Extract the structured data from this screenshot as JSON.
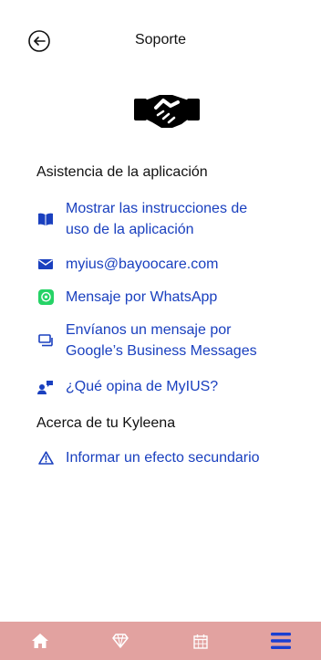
{
  "header": {
    "title": "Soporte",
    "back_icon": "arrow-left-circle-icon"
  },
  "hero": {
    "icon": "handshake-icon"
  },
  "app_support": {
    "title": "Asistencia de la aplicación",
    "items": [
      {
        "icon": "book-icon",
        "line1": "Mostrar las instrucciones de",
        "line2": "uso de la aplicación"
      },
      {
        "icon": "envelope-icon",
        "line1": "myius@bayoocare.com"
      },
      {
        "icon": "whatsapp-icon",
        "line1": "Mensaje por WhatsApp"
      },
      {
        "icon": "chat-icon",
        "line1": "Envíanos un mensaje por",
        "line2": "Google’s Business Messages"
      },
      {
        "icon": "feedback-icon",
        "line1": "¿Qué opina de MyIUS?"
      }
    ]
  },
  "about": {
    "title": "Acerca de tu Kyleena",
    "items": [
      {
        "icon": "warning-triangle-icon",
        "line1": "Informar un efecto secundario"
      }
    ]
  },
  "bottom_nav": {
    "background": "#e2a2a0",
    "items": [
      {
        "icon": "home-icon"
      },
      {
        "icon": "diamond-icon"
      },
      {
        "icon": "calendar-icon"
      },
      {
        "icon": "menu-icon",
        "active": true
      }
    ]
  },
  "colors": {
    "link": "#1a40bf",
    "text": "#111111",
    "whatsapp": "#25d366"
  }
}
